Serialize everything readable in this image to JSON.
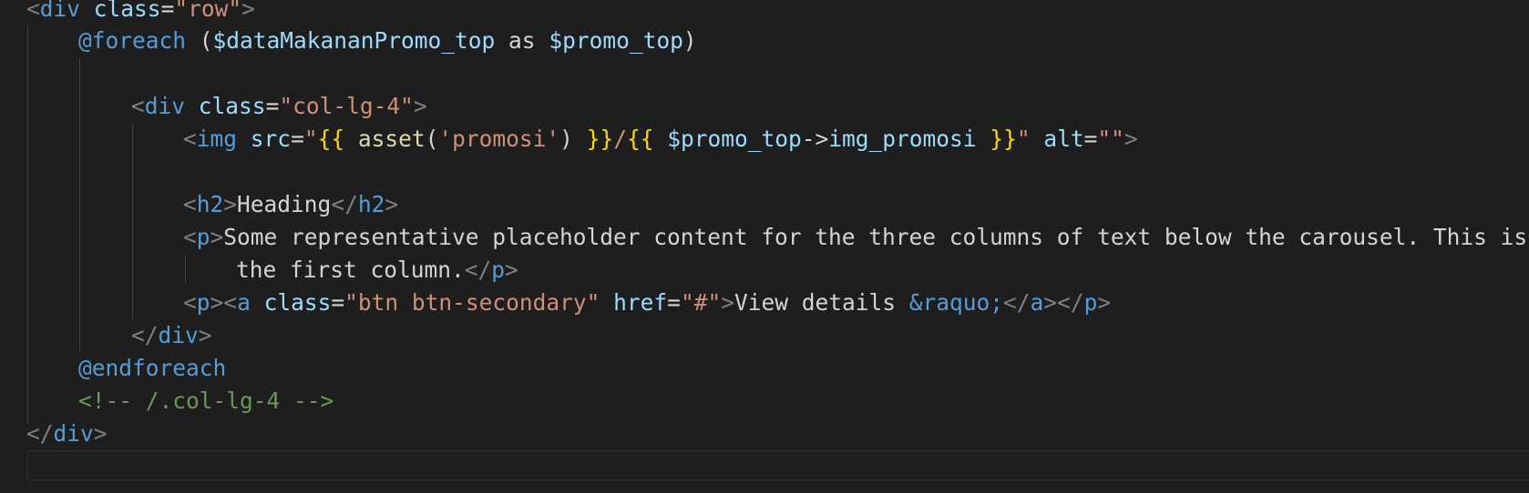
{
  "editor": {
    "lines": [
      [
        {
          "t": "<",
          "c": "pun"
        },
        {
          "t": "div",
          "c": "tag"
        },
        {
          "t": " ",
          "c": "txt"
        },
        {
          "t": "class",
          "c": "atn"
        },
        {
          "t": "=",
          "c": "txt"
        },
        {
          "t": "\"row\"",
          "c": "str"
        },
        {
          "t": ">",
          "c": "pun"
        }
      ],
      [
        {
          "t": "@foreach",
          "c": "dir"
        },
        {
          "t": " (",
          "c": "txt"
        },
        {
          "t": "$dataMakananPromo_top",
          "c": "var"
        },
        {
          "t": " as ",
          "c": "txt"
        },
        {
          "t": "$promo_top",
          "c": "var"
        },
        {
          "t": ")",
          "c": "txt"
        }
      ],
      [],
      [
        {
          "t": "<",
          "c": "pun"
        },
        {
          "t": "div",
          "c": "tag"
        },
        {
          "t": " ",
          "c": "txt"
        },
        {
          "t": "class",
          "c": "atn"
        },
        {
          "t": "=",
          "c": "txt"
        },
        {
          "t": "\"col-lg-4\"",
          "c": "str"
        },
        {
          "t": ">",
          "c": "pun"
        }
      ],
      [
        {
          "t": "<",
          "c": "pun"
        },
        {
          "t": "img",
          "c": "tag"
        },
        {
          "t": " ",
          "c": "txt"
        },
        {
          "t": "src",
          "c": "atn"
        },
        {
          "t": "=",
          "c": "txt"
        },
        {
          "t": "\"",
          "c": "str"
        },
        {
          "t": "{{",
          "c": "brk"
        },
        {
          "t": " ",
          "c": "txt"
        },
        {
          "t": "asset",
          "c": "fn"
        },
        {
          "t": "(",
          "c": "txt"
        },
        {
          "t": "'promosi'",
          "c": "str"
        },
        {
          "t": ") ",
          "c": "txt"
        },
        {
          "t": "}}",
          "c": "brk"
        },
        {
          "t": "/",
          "c": "str"
        },
        {
          "t": "{{",
          "c": "brk"
        },
        {
          "t": " ",
          "c": "txt"
        },
        {
          "t": "$promo_top",
          "c": "var"
        },
        {
          "t": "->",
          "c": "txt"
        },
        {
          "t": "img_promosi",
          "c": "var"
        },
        {
          "t": " ",
          "c": "txt"
        },
        {
          "t": "}}",
          "c": "brk"
        },
        {
          "t": "\"",
          "c": "str"
        },
        {
          "t": " ",
          "c": "txt"
        },
        {
          "t": "alt",
          "c": "atn"
        },
        {
          "t": "=",
          "c": "txt"
        },
        {
          "t": "\"\"",
          "c": "str"
        },
        {
          "t": ">",
          "c": "pun"
        }
      ],
      [],
      [
        {
          "t": "<",
          "c": "pun"
        },
        {
          "t": "h2",
          "c": "tag"
        },
        {
          "t": ">",
          "c": "pun"
        },
        {
          "t": "Heading",
          "c": "txt"
        },
        {
          "t": "</",
          "c": "pun"
        },
        {
          "t": "h2",
          "c": "tag"
        },
        {
          "t": ">",
          "c": "pun"
        }
      ],
      [
        {
          "t": "<",
          "c": "pun"
        },
        {
          "t": "p",
          "c": "tag"
        },
        {
          "t": ">",
          "c": "pun"
        },
        {
          "t": "Some representative placeholder content for the three columns of text below the carousel. This is",
          "c": "txt"
        }
      ],
      [
        {
          "t": "the first column.",
          "c": "txt"
        },
        {
          "t": "</",
          "c": "pun"
        },
        {
          "t": "p",
          "c": "tag"
        },
        {
          "t": ">",
          "c": "pun"
        }
      ],
      [
        {
          "t": "<",
          "c": "pun"
        },
        {
          "t": "p",
          "c": "tag"
        },
        {
          "t": ">",
          "c": "pun"
        },
        {
          "t": "<",
          "c": "pun"
        },
        {
          "t": "a",
          "c": "tag"
        },
        {
          "t": " ",
          "c": "txt"
        },
        {
          "t": "class",
          "c": "atn"
        },
        {
          "t": "=",
          "c": "txt"
        },
        {
          "t": "\"btn btn-secondary\"",
          "c": "str"
        },
        {
          "t": " ",
          "c": "txt"
        },
        {
          "t": "href",
          "c": "atn"
        },
        {
          "t": "=",
          "c": "txt"
        },
        {
          "t": "\"#\"",
          "c": "str"
        },
        {
          "t": ">",
          "c": "pun"
        },
        {
          "t": "View details ",
          "c": "txt"
        },
        {
          "t": "&raquo;",
          "c": "ent"
        },
        {
          "t": "</",
          "c": "pun"
        },
        {
          "t": "a",
          "c": "tag"
        },
        {
          "t": ">",
          "c": "pun"
        },
        {
          "t": "</",
          "c": "pun"
        },
        {
          "t": "p",
          "c": "tag"
        },
        {
          "t": ">",
          "c": "pun"
        }
      ],
      [
        {
          "t": "</",
          "c": "pun"
        },
        {
          "t": "div",
          "c": "tag"
        },
        {
          "t": ">",
          "c": "pun"
        }
      ],
      [
        {
          "t": "@endforeach",
          "c": "dir"
        }
      ],
      [
        {
          "t": "<!-- /.col-lg-4 -->",
          "c": "com"
        }
      ],
      [
        {
          "t": "</",
          "c": "pun"
        },
        {
          "t": "div",
          "c": "tag"
        },
        {
          "t": ">",
          "c": "pun"
        }
      ]
    ]
  }
}
